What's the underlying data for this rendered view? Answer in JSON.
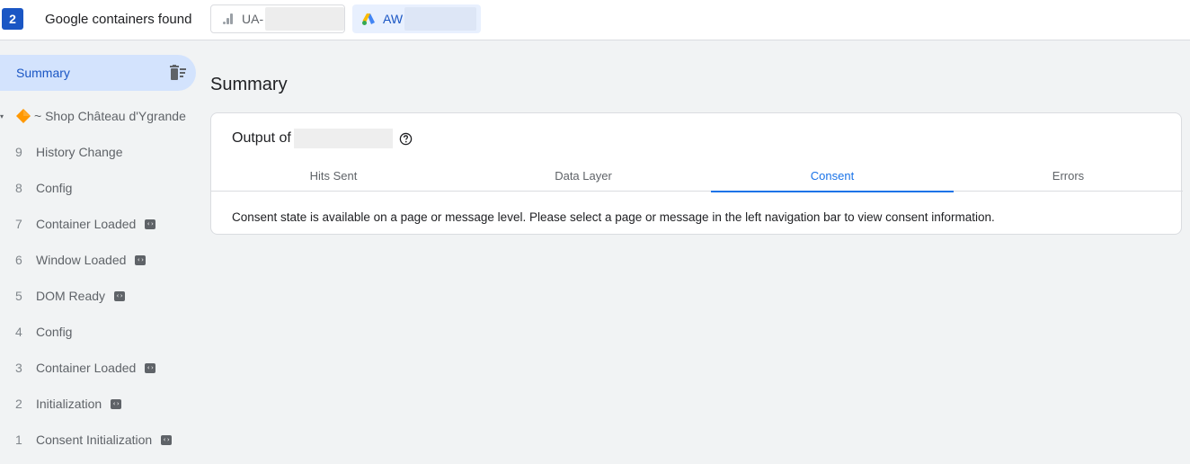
{
  "topbar": {
    "container_count": "2",
    "found_label": "Google containers found",
    "containers": [
      {
        "icon": "analytics-bars-icon",
        "prefix": "UA-",
        "id_redacted": true,
        "active": false
      },
      {
        "icon": "google-ads-icon",
        "prefix": "AW",
        "id_redacted": true,
        "active": true
      }
    ]
  },
  "sidebar": {
    "summary_label": "Summary",
    "summary_action_icon": "clear-all-icon",
    "page": {
      "icon": "orange-diamond-icon",
      "title": "~ Shop Château d'Ygrande"
    },
    "events": [
      {
        "num": "9",
        "name": "History Change",
        "has_code_icon": false
      },
      {
        "num": "8",
        "name": "Config",
        "has_code_icon": false
      },
      {
        "num": "7",
        "name": "Container Loaded",
        "has_code_icon": true
      },
      {
        "num": "6",
        "name": "Window Loaded",
        "has_code_icon": true
      },
      {
        "num": "5",
        "name": "DOM Ready",
        "has_code_icon": true
      },
      {
        "num": "4",
        "name": "Config",
        "has_code_icon": false
      },
      {
        "num": "3",
        "name": "Container Loaded",
        "has_code_icon": true
      },
      {
        "num": "2",
        "name": "Initialization",
        "has_code_icon": true
      },
      {
        "num": "1",
        "name": "Consent Initialization",
        "has_code_icon": true
      }
    ]
  },
  "main": {
    "title": "Summary",
    "output_label": "Output of",
    "output_target_redacted": true,
    "tabs": [
      {
        "label": "Hits Sent",
        "active": false
      },
      {
        "label": "Data Layer",
        "active": false
      },
      {
        "label": "Consent",
        "active": true
      },
      {
        "label": "Errors",
        "active": false
      }
    ],
    "message": "Consent state is available on a page or message level. Please select a page or message in the left navigation bar to view consent information."
  },
  "colors": {
    "accent": "#1a73e8",
    "badge": "#1a56c4",
    "selected_bg": "#d3e3fd",
    "background": "#f1f3f4"
  }
}
